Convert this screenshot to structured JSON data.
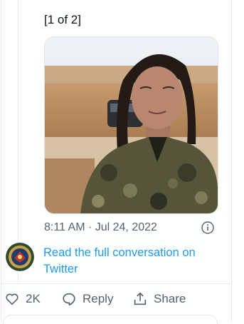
{
  "tweet": {
    "text": "[1 of 2]",
    "image_alt": "Photo of a woman in camouflage uniform outdoors",
    "timestamp": "8:11 AM · Jul 24, 2022"
  },
  "conversation_link": "Read the full conversation on Twitter",
  "actions": {
    "like_count": "2K",
    "reply_label": "Reply",
    "share_label": "Share"
  },
  "colors": {
    "link": "#1d9bf0",
    "muted": "#536471",
    "border": "#e3e8ec"
  },
  "icons": [
    "info-icon",
    "heart-icon",
    "reply-icon",
    "share-icon",
    "avatar-emblem"
  ]
}
